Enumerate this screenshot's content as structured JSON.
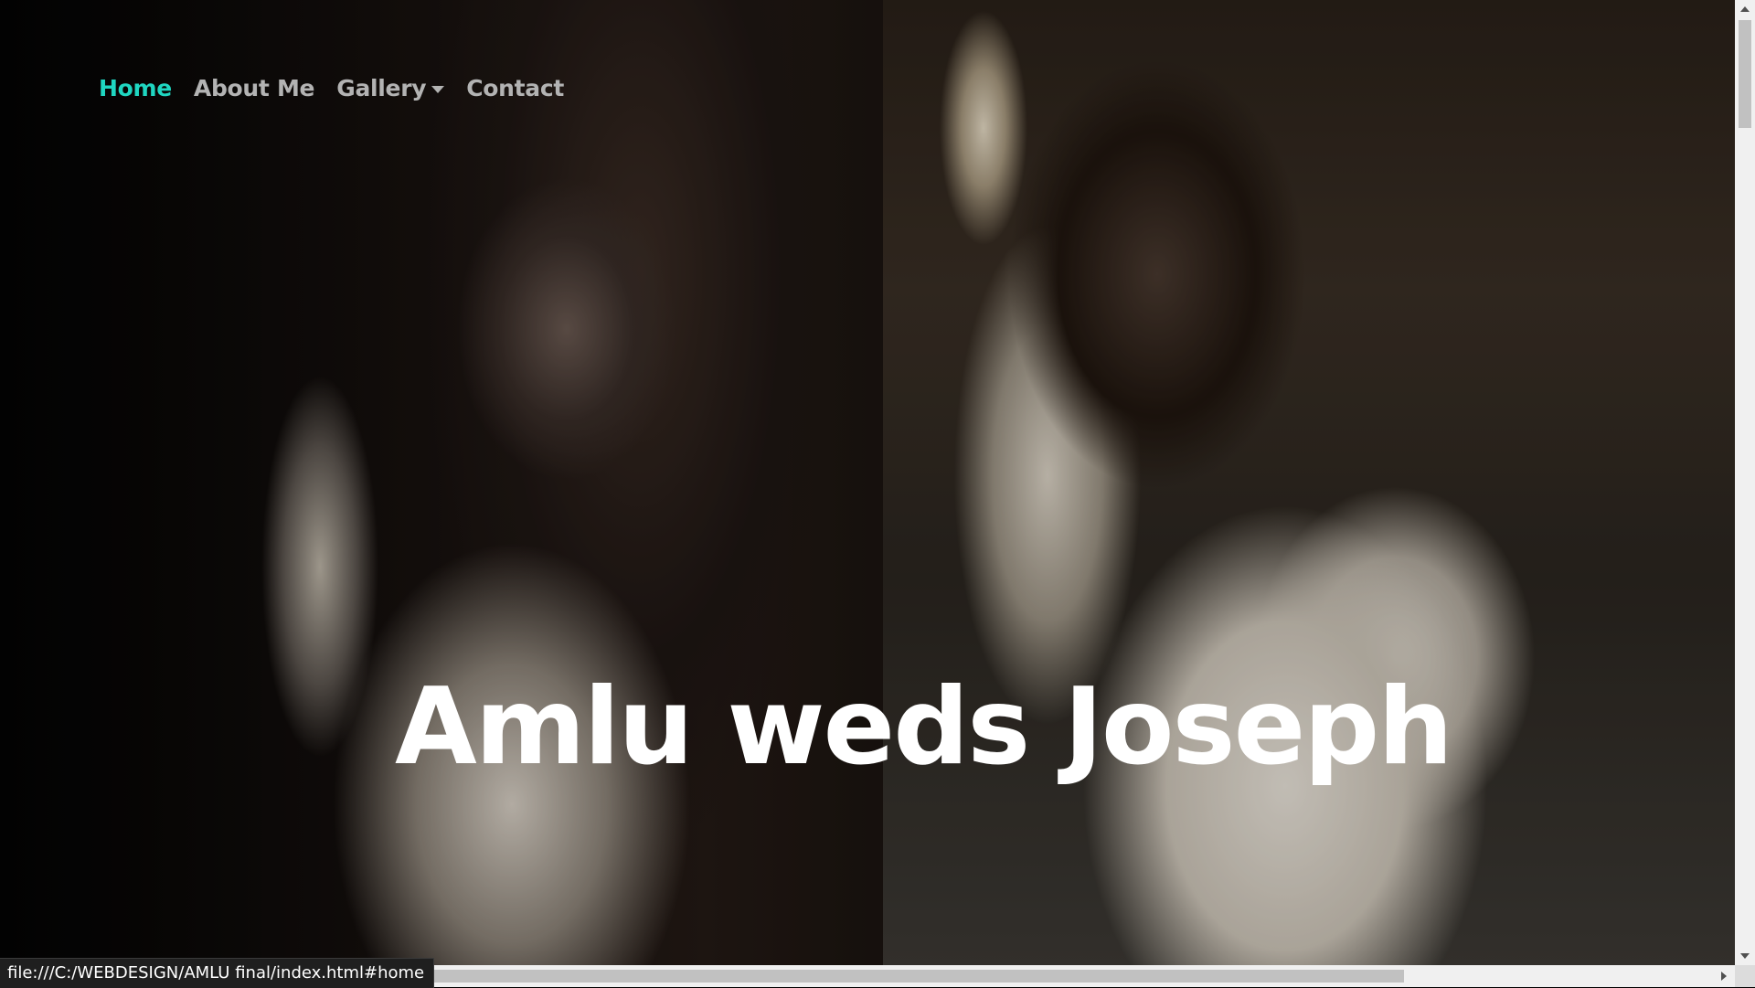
{
  "nav": {
    "items": [
      {
        "label": "Home",
        "active": true
      },
      {
        "label": "About Me",
        "active": false
      },
      {
        "label": "Gallery",
        "active": false,
        "dropdown": true
      },
      {
        "label": "Contact",
        "active": false
      }
    ]
  },
  "hero": {
    "title_part1_cap": "A",
    "title_part1_rest": "mlu weds ",
    "title_part2_cap": "J",
    "title_part2_rest": "oseph"
  },
  "status_bar": {
    "url": "file:///C:/WEBDESIGN/AMLU final/index.html#home"
  },
  "colors": {
    "active_nav": "#1fd6c1",
    "nav": "#b3b3b3",
    "title": "#ffffff"
  },
  "icons": {
    "gallery_dropdown": "caret-down-icon",
    "scroll_up": "arrow-up-icon",
    "scroll_down": "arrow-down-icon",
    "scroll_right": "arrow-right-icon"
  }
}
